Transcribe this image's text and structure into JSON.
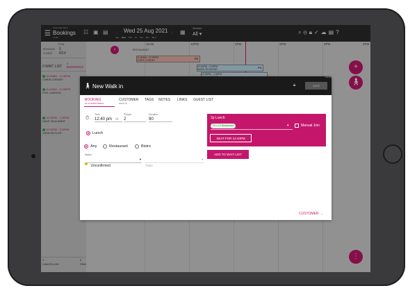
{
  "topbar": {
    "venue": "Greenvale Store",
    "title": "Bookings",
    "subtitle": "v1.94",
    "date": "Wed 25 Aug 2021",
    "days": [
      "Tue",
      "Wed",
      "Thu",
      "Fri",
      "Sat",
      "Sun",
      "Mon"
    ],
    "section_label": "Section",
    "section_value": "All"
  },
  "left_panel": {
    "total_label": "TOTAL",
    "bookings_label": "BOOKINGS",
    "bookings_value": "5",
    "covers_label": "COVERS",
    "covers_value": "6/14",
    "wait_list_label": "0 WAIT LIST",
    "bookings_tab_count": "4",
    "bookings_tab_label": "BOOKINGS",
    "seated_count": "1",
    "seated_label": "SEATED",
    "bookings": [
      {
        "time": "11:00AM - 12:30PM",
        "name": "CHRIS CHENEY"
      },
      {
        "time": "11:00AM - 12:30PM",
        "name": "PHIL LAMSON"
      },
      {
        "time": "12:00PM - 1:30PM",
        "name": "DAVE FAULKNER"
      },
      {
        "time": "12:30PM - 2:30PM",
        "name": "JOHN BUTLER"
      }
    ],
    "cancelled_count": "1",
    "cancelled_label": "CANCELLED",
    "finished_count": "0",
    "finished_label": "FINISHED"
  },
  "timeline": {
    "times": [
      "11AM",
      "12PM",
      "1PM",
      "2PM",
      "3PM",
      "4PM"
    ],
    "section_name": "RESTAURANT",
    "reservations": [
      {
        "time": "11:00AM - 12:30PM",
        "name": "CHRIS CHENEY",
        "tag": "P2"
      },
      {
        "time": "12:00PM - 2:00PM",
        "name": "MARK SEYMOUR",
        "tag": "P4"
      },
      {
        "time": "12:30PM - 2:30PM",
        "name": "JOHN BUTLER",
        "tag": "P4"
      }
    ]
  },
  "modal": {
    "title": "New Walk in",
    "save_label": "SAVE",
    "status_time": "4:19 PM",
    "tabs": [
      {
        "label": "BOOKING",
        "sub": "2P 12:40PM 25/8/21"
      },
      {
        "label": "CUSTOMER",
        "sub": "WALK IN"
      },
      {
        "label": "TAGS",
        "sub": ""
      },
      {
        "label": "NOTES",
        "sub": ""
      },
      {
        "label": "LINKS",
        "sub": ""
      },
      {
        "label": "GUEST LIST",
        "sub": ""
      }
    ],
    "time_label": "Time",
    "time_value": "12:40 pm",
    "people_label": "People",
    "people_value": "2",
    "duration_label": "Duration",
    "duration_value": "90",
    "service_options": [
      "Lunch"
    ],
    "area_options": [
      "Any",
      "Restaurant",
      "Bistro"
    ],
    "status_label": "Status",
    "status_value": "Unconfirmed",
    "table_placeholder": "Table",
    "table_card": {
      "title": "2p Lunch",
      "chip": "T9 • C4 Restaurant",
      "manual_join_label": "Manual Join",
      "seat_button": "SEAT FOR 12:40PM"
    },
    "wait_list_button": "ADD TO WAIT LIST",
    "customer_link": "CUSTOMER"
  },
  "colors": {
    "accent": "#c4176c",
    "topbar": "#2b2b2d",
    "modal_header": "#1a1a1a"
  }
}
